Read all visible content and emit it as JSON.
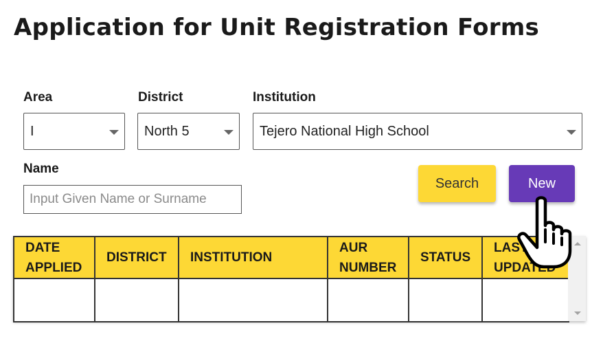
{
  "page_title": "Application for Unit Registration Forms",
  "filters": {
    "area": {
      "label": "Area",
      "value": "I"
    },
    "district": {
      "label": "District",
      "value": "North 5"
    },
    "institution": {
      "label": "Institution",
      "value": "Tejero National High School"
    },
    "name": {
      "label": "Name",
      "value": "",
      "placeholder": "Input Given Name or Surname"
    }
  },
  "buttons": {
    "search": "Search",
    "new": "New"
  },
  "colors": {
    "accent_yellow": "#fdd835",
    "accent_purple": "#673ab7"
  },
  "table": {
    "columns": [
      {
        "label": "DATE APPLIED"
      },
      {
        "label": "DISTRICT"
      },
      {
        "label": "INSTITUTION"
      },
      {
        "label": "AUR NUMBER"
      },
      {
        "label": "STATUS"
      },
      {
        "label": "LAST UPDATED"
      }
    ],
    "rows": [
      [
        "",
        "",
        "",
        "",
        "",
        ""
      ]
    ]
  },
  "cursor": {
    "icon": "hand-pointer-icon"
  }
}
